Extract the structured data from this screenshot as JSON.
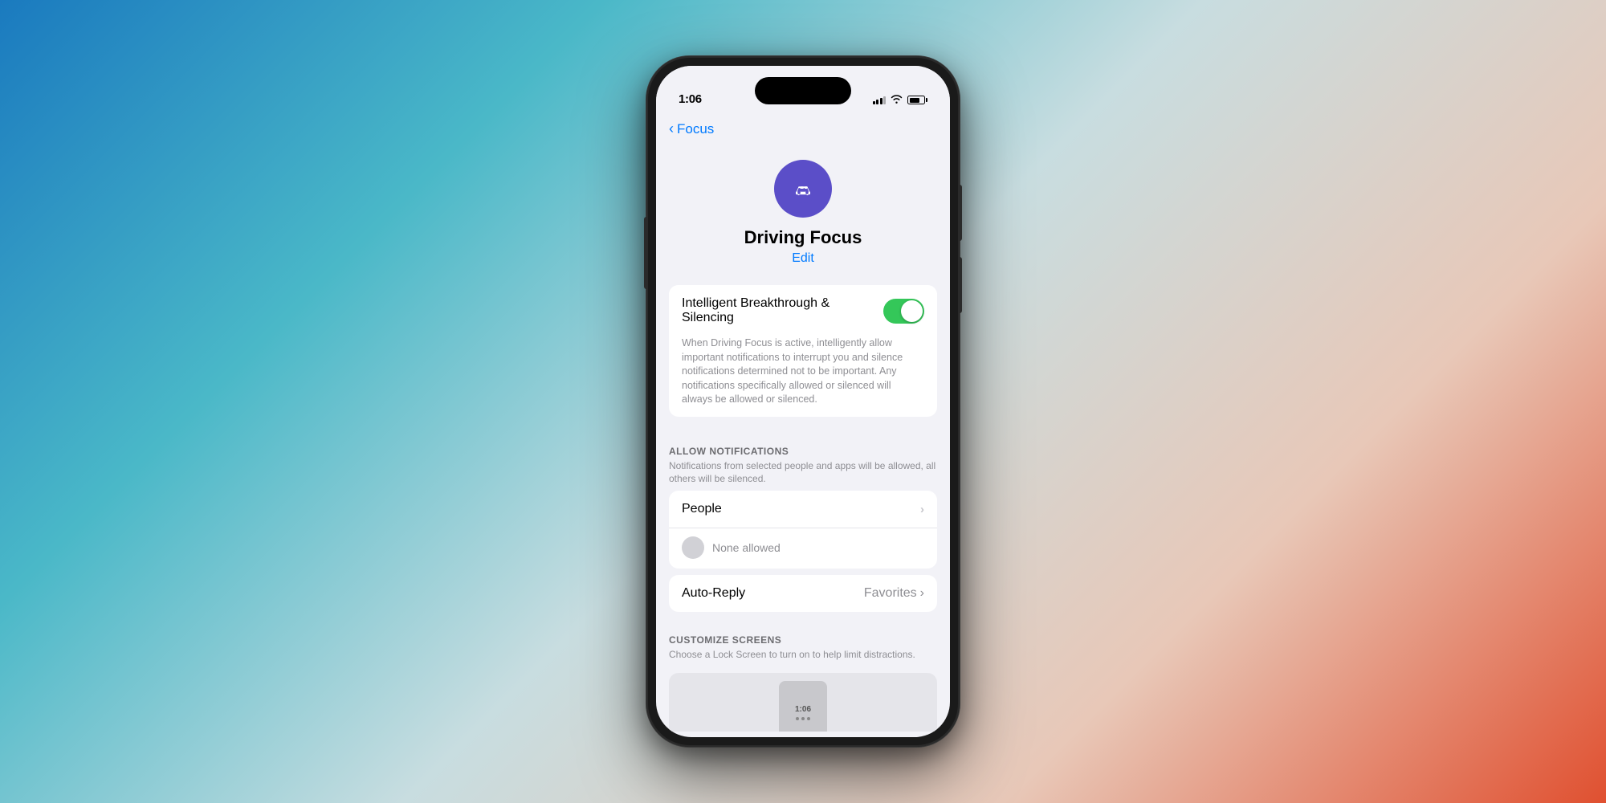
{
  "background": {
    "gradient": "blue-to-red"
  },
  "statusBar": {
    "time": "1:06",
    "signalBars": [
      3,
      5,
      6,
      8,
      10
    ],
    "batteryLevel": 75
  },
  "navigation": {
    "backLabel": "Focus",
    "backChevron": "‹"
  },
  "focusHeader": {
    "iconName": "car-icon",
    "title": "Driving Focus",
    "editLabel": "Edit"
  },
  "intelligentSection": {
    "toggleLabel": "Intelligent Breakthrough & Silencing",
    "toggleState": true,
    "description": "When Driving Focus is active, intelligently allow important notifications to interrupt you and silence notifications determined not to be important. Any notifications specifically allowed or silenced will always be allowed or silenced."
  },
  "allowNotifications": {
    "sectionTitle": "ALLOW NOTIFICATIONS",
    "sectionSubtitle": "Notifications from selected people and apps will be allowed, all others will be silenced.",
    "people": {
      "label": "People",
      "noneAllowedText": "None allowed",
      "chevron": "›"
    },
    "autoReply": {
      "label": "Auto-Reply",
      "value": "Favorites",
      "chevron": "›"
    }
  },
  "customizeScreens": {
    "sectionTitle": "CUSTOMIZE SCREENS",
    "sectionSubtitle": "Choose a Lock Screen to turn on to help limit distractions.",
    "lockPreview": {
      "time": "1:06",
      "dots": 3
    }
  }
}
